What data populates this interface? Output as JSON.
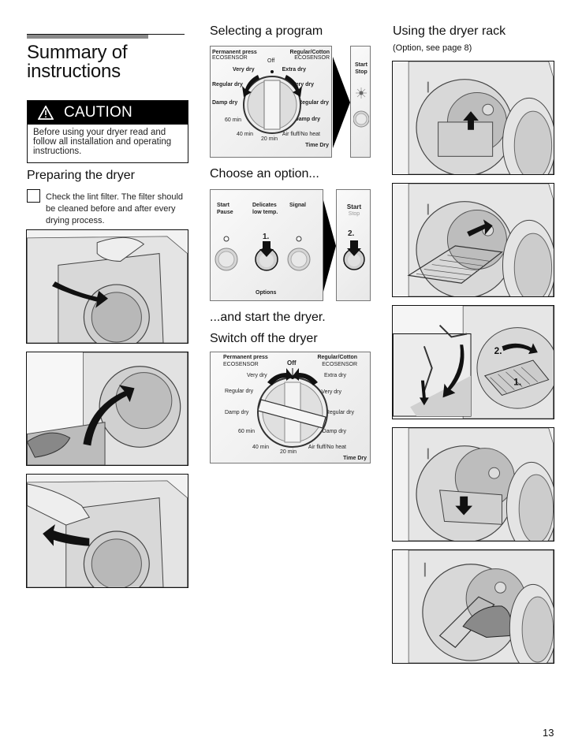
{
  "page": {
    "title_line1": "Summary of",
    "title_line2": "instructions",
    "page_number": "13"
  },
  "caution": {
    "icon": "warning-triangle-icon",
    "label": "CAUTION",
    "text": "Before using your dryer read and follow all installation and operating instructions."
  },
  "preparing": {
    "heading": "Preparing the dryer",
    "checklist_text": "Check the lint filter. The filter should be cleaned before and after every drying process.",
    "figures": [
      "open-door-illustration",
      "load-laundry-illustration",
      "close-door-illustration"
    ]
  },
  "selecting": {
    "heading": "Selecting a program",
    "dial": {
      "top_left_program": "Permanent press",
      "top_left_sensor": "ECOSENSOR",
      "top_right_program": "Regular/Cotton",
      "top_right_sensor": "ECOSENSOR",
      "off_label": "Off",
      "left_labels": [
        "Very dry",
        "Regular dry",
        "Damp dry"
      ],
      "right_labels": [
        "Extra dry",
        "Very dry",
        "Regular dry",
        "Damp dry"
      ],
      "time_labels": [
        "60 min",
        "40 min",
        "20 min"
      ],
      "air_label": "Air fluff/No heat",
      "time_dry_label": "Time Dry"
    },
    "start_panel": {
      "line1": "Start",
      "line2": "Stop"
    }
  },
  "options": {
    "heading": "Choose an option...",
    "buttons": [
      {
        "line1": "Start",
        "line2": "Pause"
      },
      {
        "line1": "Delicates",
        "line2": "low temp.",
        "step": "1."
      },
      {
        "line1": "Signal",
        "line2": ""
      }
    ],
    "footer": "Options",
    "start_panel": {
      "line1": "Start",
      "line2": "Stop",
      "step": "2."
    }
  },
  "start": {
    "heading": "...and start the dryer."
  },
  "switch_off": {
    "heading": "Switch off the dryer"
  },
  "rack": {
    "heading": "Using the dryer rack",
    "subheading": "(Option, see page 8)",
    "inset_steps": [
      "1.",
      "2."
    ],
    "figures": [
      "insert-rack-illustration",
      "slide-rack-illustration",
      "hook-rack-illustration",
      "basket-illustration",
      "shoes-on-rack-illustration"
    ]
  }
}
